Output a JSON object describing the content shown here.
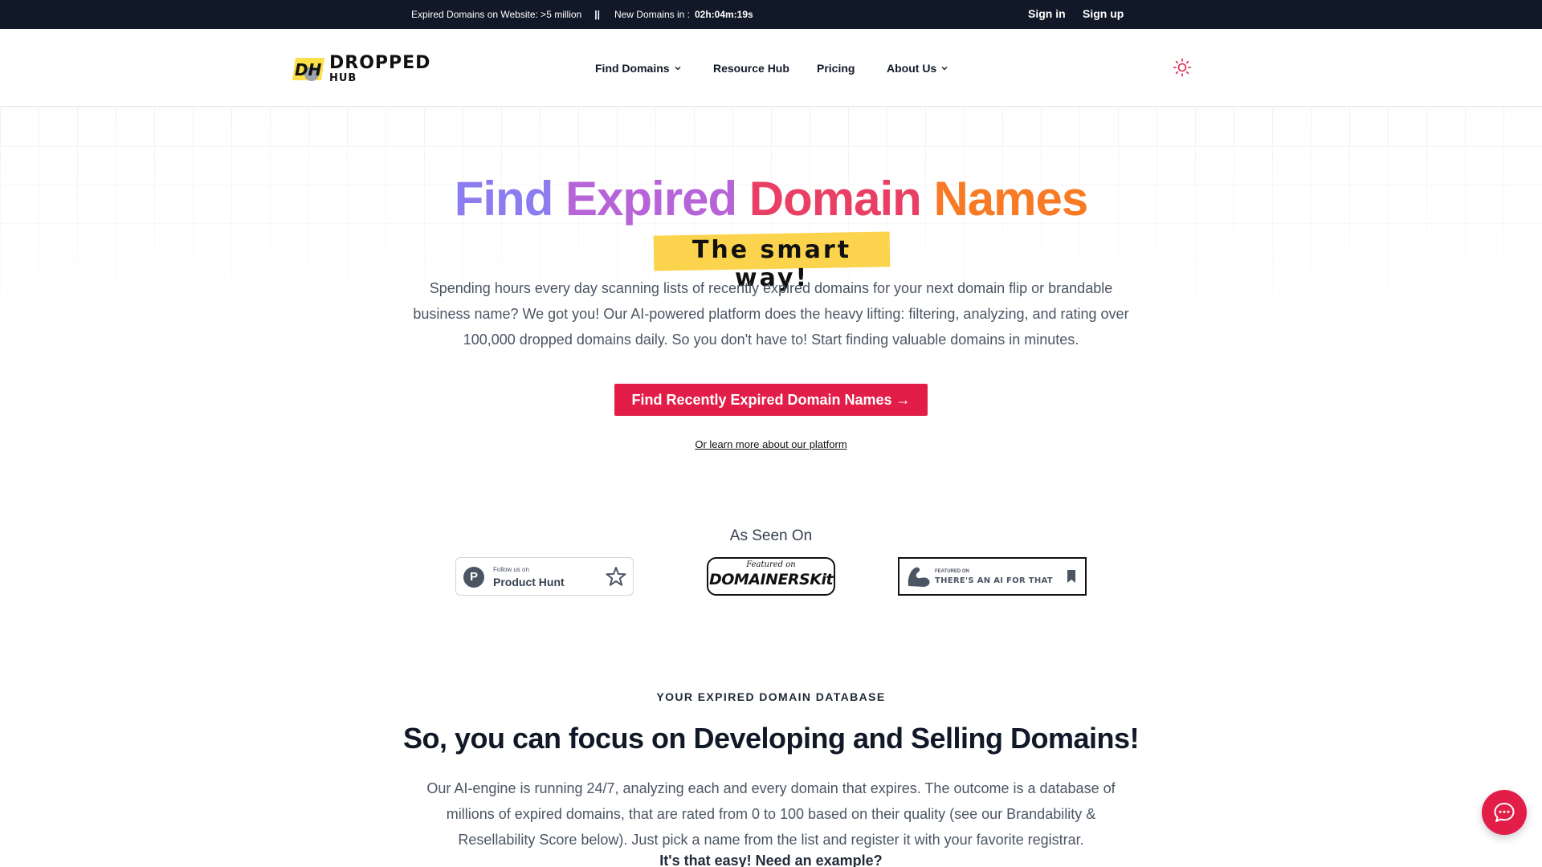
{
  "topbar": {
    "expired_label": "Expired Domains on Website: >5 million",
    "separator": "||",
    "new_label": "New Domains in :",
    "timer": "02h:04m:19s",
    "sign_in": "Sign in",
    "sign_up": "Sign up"
  },
  "header": {
    "logo_mark": "DH",
    "logo_word1": "DROPPED",
    "logo_word2": "HUB",
    "nav": [
      "Find Domains",
      "Resource Hub",
      "Pricing",
      "About Us"
    ],
    "theme_icon": "sun-icon"
  },
  "hero": {
    "title_words": [
      "Find",
      "Expired",
      "Domain",
      "Names"
    ],
    "title_colors": [
      "#8b7cf0",
      "#b764d8",
      "#ea3f64",
      "#f97a25"
    ],
    "tagline": "The smart way!",
    "description": "Spending hours every day scanning lists of recently expired domains for your next domain flip or brandable business name? We got you! Our AI-powered platform does the heavy lifting: filtering, analyzing, and rating over 100,000 dropped domains daily. So you don't have to! Start finding valuable domains in minutes.",
    "cta": "Find Recently Expired Domain Names →",
    "learn_more": "Or learn more about our platform"
  },
  "seen_on": {
    "heading": "As Seen On",
    "product_hunt": {
      "small": "Follow us on",
      "big": "Product Hunt",
      "letter": "P"
    },
    "domainerskit": {
      "small": "Featured on",
      "big": "DOMAINERSKit"
    },
    "ai_for_that": {
      "small": "FEATURED ON",
      "big": "THERE'S AN AI FOR THAT"
    }
  },
  "database": {
    "eyebrow": "YOUR EXPIRED DOMAIN DATABASE",
    "title": "So, you can focus on Developing and Selling Domains!",
    "description": "Our AI-engine is running 24/7, analyzing each and every domain that expires. The outcome is a database of millions of expired domains, that are rated from 0 to 100 based on their quality (see our Brandability & Resellability Score below). Just pick a name from the list and register it with your favorite registrar.",
    "strong": "It's that easy! Need an example?"
  },
  "colors": {
    "brand": "#e11d48",
    "topbar": "#111827",
    "highlight": "#fcd34d"
  }
}
